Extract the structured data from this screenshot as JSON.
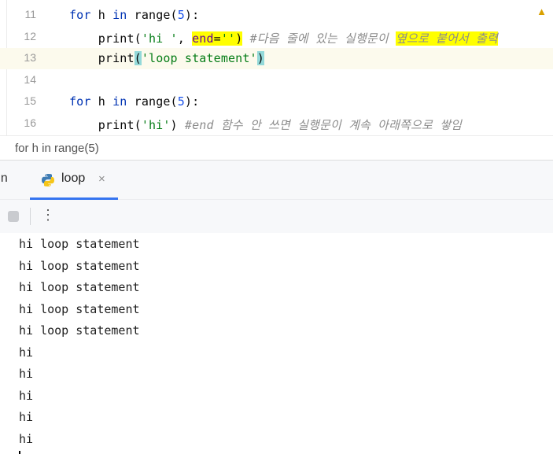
{
  "editor": {
    "lines": [
      {
        "no": "11",
        "tokens": [
          {
            "t": "for",
            "c": "kw"
          },
          {
            "t": " h "
          },
          {
            "t": "in",
            "c": "kw"
          },
          {
            "t": " range("
          },
          {
            "t": "5",
            "c": "num"
          },
          {
            "t": "):"
          }
        ]
      },
      {
        "no": "12",
        "tokens": [
          {
            "t": "    print("
          },
          {
            "t": "'hi '",
            "c": "str"
          },
          {
            "t": ", "
          },
          {
            "t": "end",
            "c": "param hl-yellow"
          },
          {
            "t": "=",
            "c": "hl-yellow"
          },
          {
            "t": "''",
            "c": "str hl-yellow"
          },
          {
            "t": ")",
            "c": "hl-yellow"
          },
          {
            "t": " "
          },
          {
            "t": "#다음 줄에 있는 실행문이 ",
            "c": "cmt"
          },
          {
            "t": "옆으로 붙어서 출력",
            "c": "cmt hl-yellow"
          }
        ]
      },
      {
        "no": "13",
        "current": true,
        "tokens": [
          {
            "t": "    print"
          },
          {
            "t": "(",
            "c": "hl-teal"
          },
          {
            "t": "'loop statement'",
            "c": "str"
          },
          {
            "t": ")",
            "c": "hl-teal"
          }
        ]
      },
      {
        "no": "14",
        "tokens": []
      },
      {
        "no": "15",
        "tokens": [
          {
            "t": "for",
            "c": "kw"
          },
          {
            "t": " h "
          },
          {
            "t": "in",
            "c": "kw"
          },
          {
            "t": " range("
          },
          {
            "t": "5",
            "c": "num"
          },
          {
            "t": "):"
          }
        ]
      },
      {
        "no": "16",
        "tokens": [
          {
            "t": "    print("
          },
          {
            "t": "'hi'",
            "c": "str"
          },
          {
            "t": ") "
          },
          {
            "t": "#end 함수 안 쓰면 실행문이 계속 아래쪽으로 쌓임",
            "c": "cmt"
          }
        ]
      }
    ],
    "warning_icon": "warning-triangle-icon",
    "warning_text": "▲"
  },
  "breadcrumb": {
    "text": "for h in range(5)"
  },
  "tool_window": {
    "title": "un",
    "tab_label": "loop",
    "tab_close": "×",
    "more_glyph": "⋮",
    "accent_color": "#3574f0"
  },
  "console": {
    "lines": [
      "hi loop statement",
      "hi loop statement",
      "hi loop statement",
      "hi loop statement",
      "hi loop statement",
      "hi",
      "hi",
      "hi",
      "hi",
      "hi"
    ]
  }
}
